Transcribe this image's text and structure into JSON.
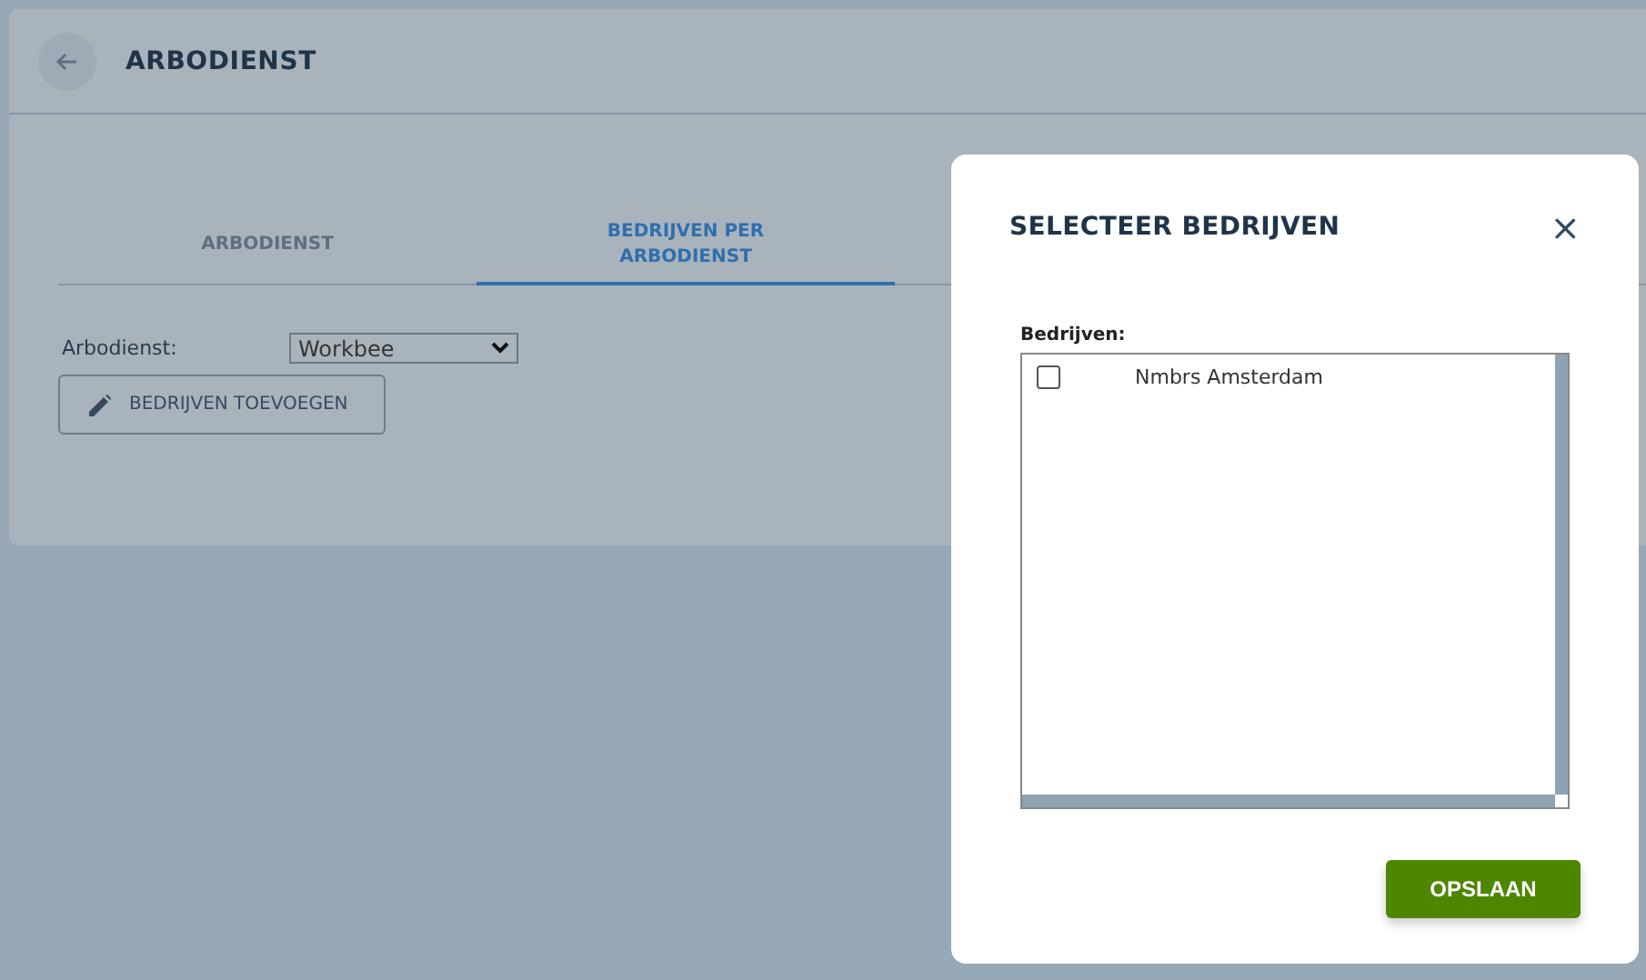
{
  "page": {
    "title": "ARBODIENST"
  },
  "tabs": [
    {
      "label": "ARBODIENST",
      "selected": false
    },
    {
      "label": "BEDRIJVEN PER ARBODIENST",
      "selected": true
    }
  ],
  "form": {
    "label": "Arbodienst:",
    "value": "Workbee",
    "button": "BEDRIJVEN TOEVOEGEN"
  },
  "dialog": {
    "title": "SELECTEER BEDRIJVEN",
    "close": "×",
    "list_label": "Bedrijven:",
    "items": [
      {
        "label": "Nmbrs Amsterdam",
        "checked": false
      }
    ],
    "button": "OPSLAAN"
  }
}
